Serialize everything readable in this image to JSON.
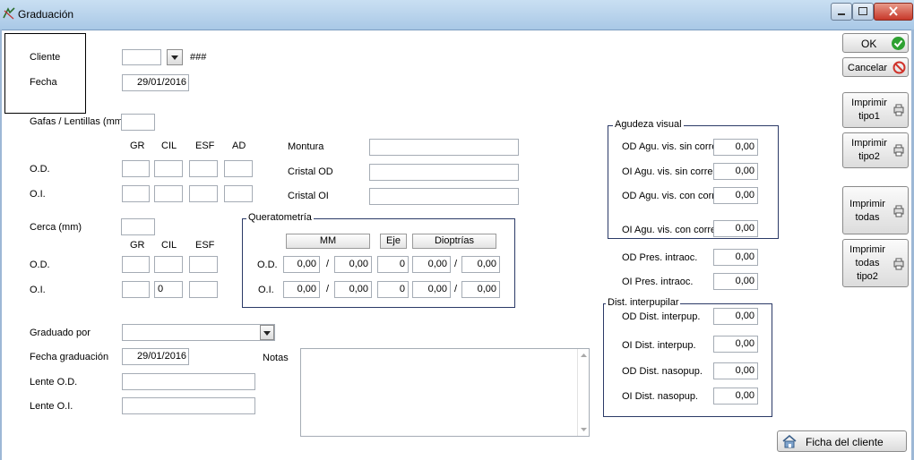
{
  "window": {
    "title": "Graduación"
  },
  "cliente": {
    "label": "Cliente",
    "value": "",
    "hash": "###"
  },
  "fecha": {
    "label": "Fecha",
    "value": "29/01/2016"
  },
  "gafas": {
    "label": "Gafas / Lentillas (mm)",
    "value": "",
    "columns": [
      "GR",
      "CIL",
      "ESF",
      "AD"
    ],
    "rows": [
      {
        "label": "O.D.",
        "values": [
          "",
          "",
          "",
          ""
        ]
      },
      {
        "label": "O.I.",
        "values": [
          "",
          "",
          "",
          ""
        ]
      }
    ]
  },
  "cerca": {
    "label": "Cerca (mm)",
    "value": "",
    "columns": [
      "GR",
      "CIL",
      "ESF"
    ],
    "rows": [
      {
        "label": "O.D.",
        "values": [
          "",
          "",
          ""
        ]
      },
      {
        "label": "O.I.",
        "values": [
          "",
          "0",
          ""
        ]
      }
    ]
  },
  "montura": {
    "label": "Montura",
    "value": ""
  },
  "cristal_od": {
    "label": "Cristal OD",
    "value": ""
  },
  "cristal_oi": {
    "label": "Cristal OI",
    "value": ""
  },
  "queratometria": {
    "title": "Queratometría",
    "headers": [
      "MM",
      "Eje",
      "Dioptrías"
    ],
    "sep": "/",
    "rows": [
      {
        "label": "O.D.",
        "mm1": "0,00",
        "mm2": "0,00",
        "eje": "0",
        "d1": "0,00",
        "d2": "0,00"
      },
      {
        "label": "O.I.",
        "mm1": "0,00",
        "mm2": "0,00",
        "eje": "0",
        "d1": "0,00",
        "d2": "0,00"
      }
    ]
  },
  "graduado_por": {
    "label": "Graduado por",
    "value": ""
  },
  "fecha_graduacion": {
    "label": "Fecha graduación",
    "value": "29/01/2016"
  },
  "lente_od": {
    "label": "Lente O.D.",
    "value": ""
  },
  "lente_oi": {
    "label": "Lente O.I.",
    "value": ""
  },
  "notas": {
    "label": "Notas",
    "value": ""
  },
  "agudeza": {
    "title": "Agudeza visual",
    "rows": [
      {
        "label": "OD Agu. vis. sin corre.",
        "value": "0,00"
      },
      {
        "label": "OI Agu. vis. sin corre.",
        "value": "0,00"
      },
      {
        "label": "OD Agu. vis. con corre.",
        "value": "0,00"
      },
      {
        "label": "OI Agu. vis. con corre.",
        "value": "0,00"
      }
    ]
  },
  "presion": {
    "rows": [
      {
        "label": "OD Pres. intraoc.",
        "value": "0,00"
      },
      {
        "label": "OI Pres. intraoc.",
        "value": "0,00"
      }
    ]
  },
  "dist": {
    "title": "Dist. interpupilar",
    "rows": [
      {
        "label": "OD Dist. interpup.",
        "value": "0,00"
      },
      {
        "label": "OI Dist. interpup.",
        "value": "0,00"
      },
      {
        "label": "OD Dist. nasopup.",
        "value": "0,00"
      },
      {
        "label": "OI Dist. nasopup.",
        "value": "0,00"
      }
    ]
  },
  "buttons": {
    "ok": "OK",
    "cancelar": "Cancelar",
    "imprimir_tipo1": [
      "Imprimir",
      "tipo1"
    ],
    "imprimir_tipo2": [
      "Imprimir",
      "tipo2"
    ],
    "imprimir_todas": [
      "Imprimir",
      "todas"
    ],
    "imprimir_todas_tipo2": [
      "Imprimir",
      "todas",
      "tipo2"
    ],
    "ficha": "Ficha del cliente"
  },
  "colors": {
    "ok_green": "#2da131",
    "cancel_red": "#d0342c",
    "group_border": "#2b3a67"
  }
}
